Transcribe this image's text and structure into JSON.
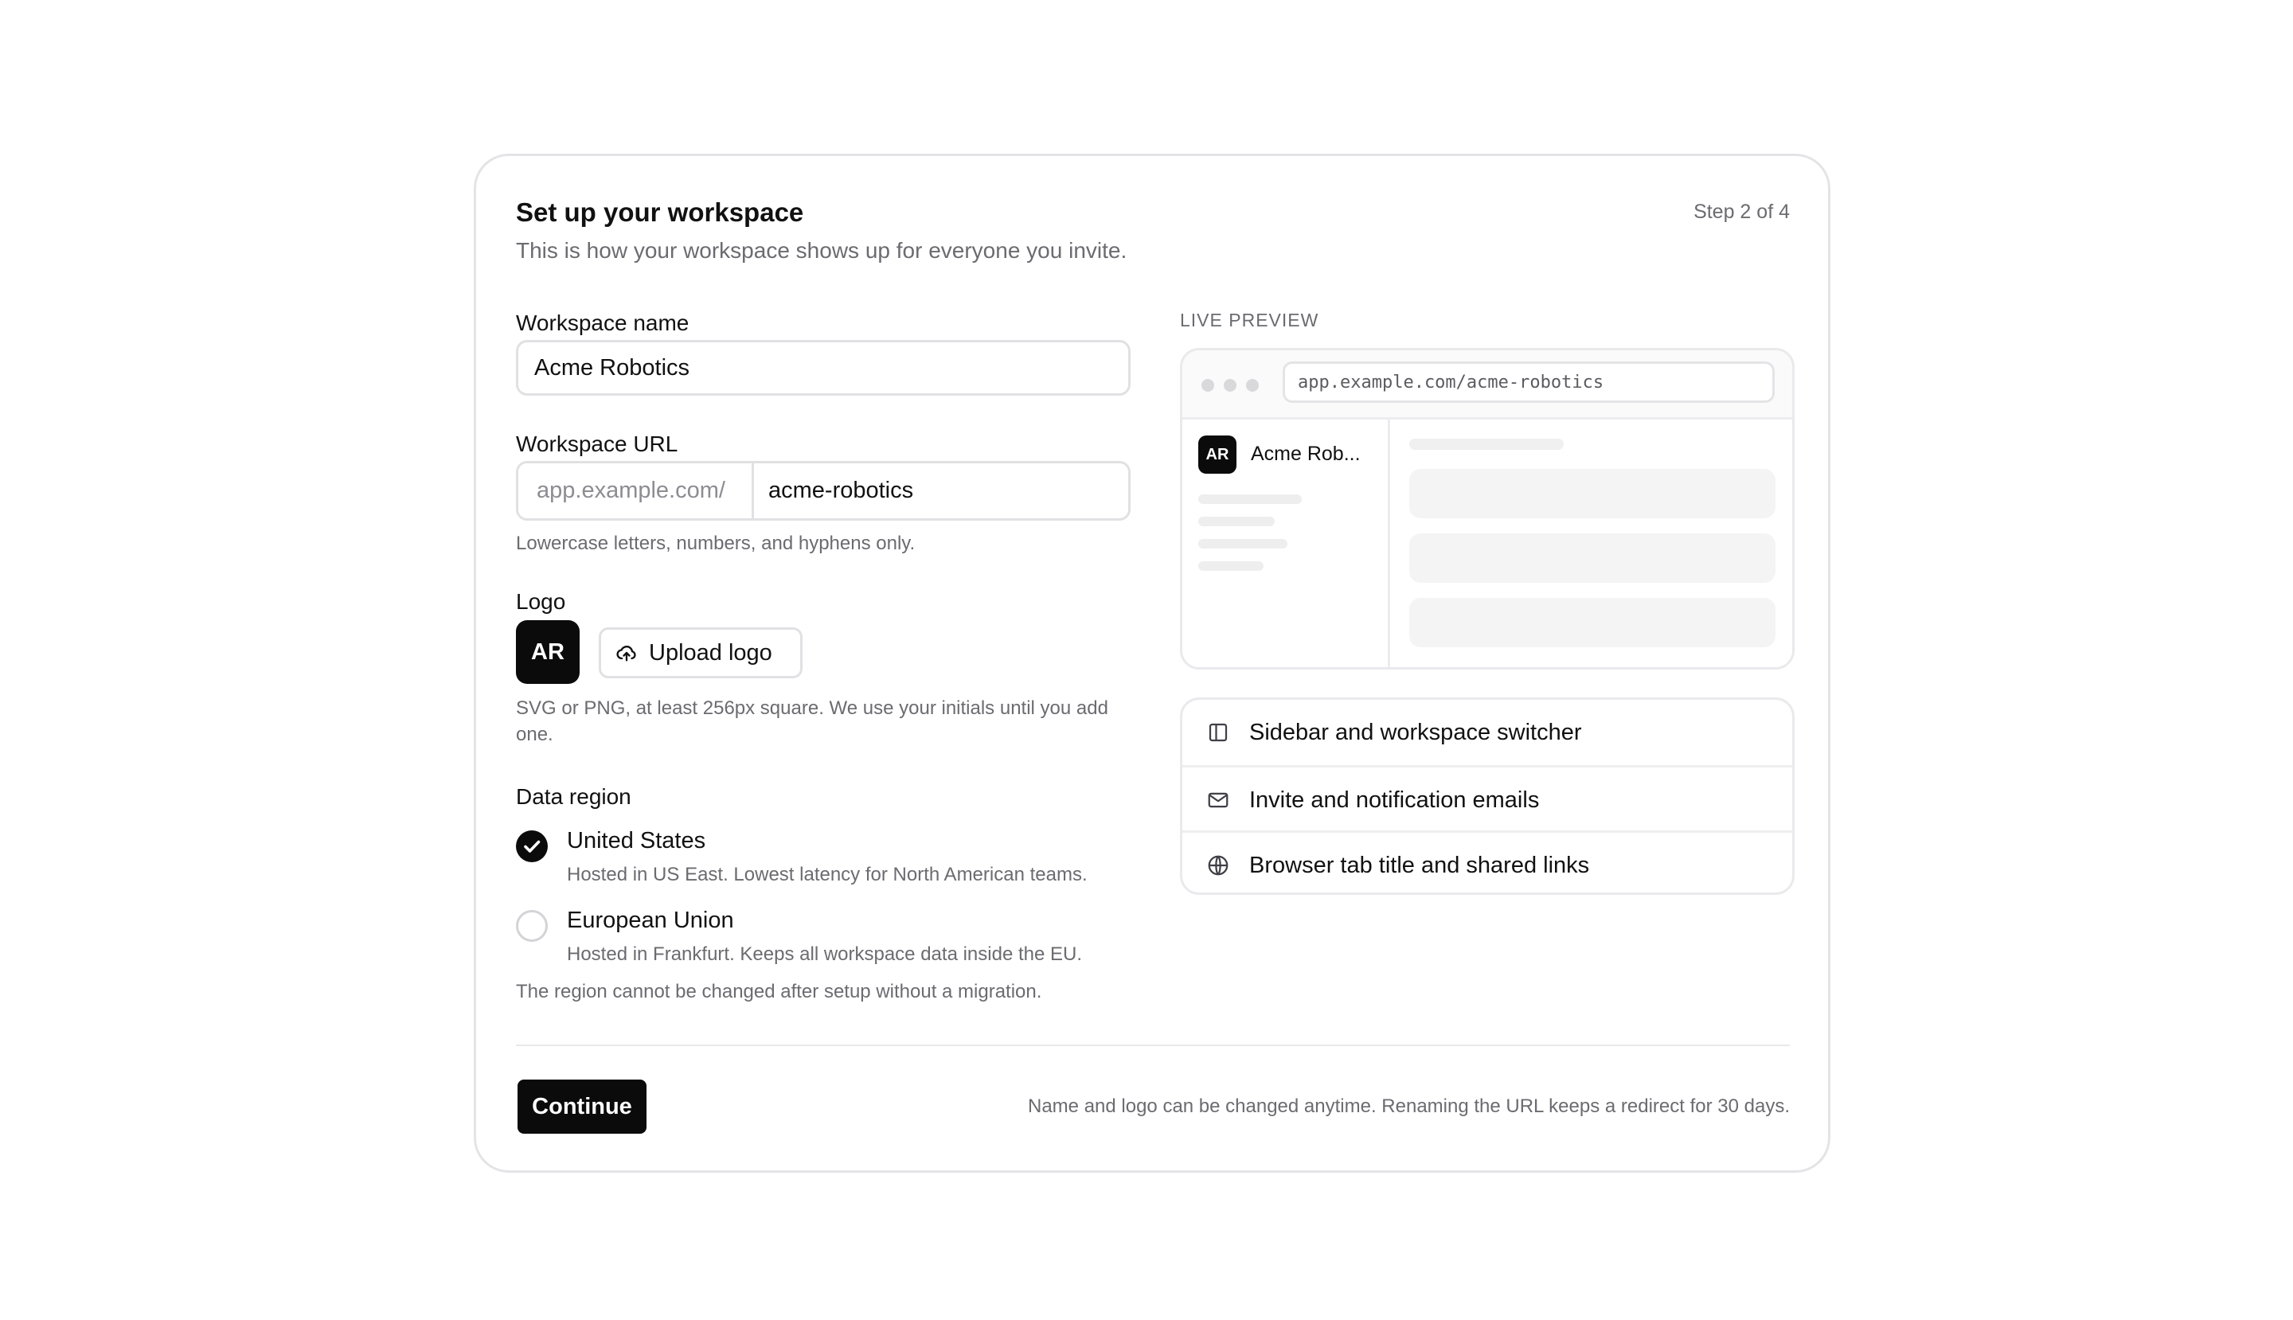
{
  "header": {
    "title": "Set up your workspace",
    "subtitle": "This is how your workspace shows up for everyone you invite.",
    "step": "Step 2 of 4"
  },
  "form": {
    "name_label": "Workspace name",
    "name_value": "Acme Robotics",
    "url_label": "Workspace URL",
    "url_prefix": "app.example.com/",
    "url_value": "acme-robotics",
    "url_help": "Lowercase letters, numbers, and hyphens only.",
    "logo_label": "Logo",
    "logo_initials": "AR",
    "upload_label": "Upload logo",
    "logo_help": "SVG or PNG, at least 256px square. We use your initials until you add one.",
    "region_label": "Data region",
    "regions": [
      {
        "title": "United States",
        "desc": "Hosted in US East. Lowest latency for North American teams.",
        "selected": true
      },
      {
        "title": "European Union",
        "desc": "Hosted in Frankfurt. Keeps all workspace data inside the EU.",
        "selected": false
      }
    ],
    "region_note": "The region cannot be changed after setup without a migration."
  },
  "preview": {
    "label": "LIVE PREVIEW",
    "address": "app.example.com/acme-robotics",
    "avatar": "AR",
    "name": "Acme Rob..."
  },
  "features": [
    {
      "icon": "sidebar-icon",
      "label": "Sidebar and workspace switcher"
    },
    {
      "icon": "mail-icon",
      "label": "Invite and notification emails"
    },
    {
      "icon": "globe-icon",
      "label": "Browser tab title and shared links"
    }
  ],
  "footer": {
    "continue_label": "Continue",
    "note": "Name and logo can be changed anytime. Renaming the URL keeps a redirect for 30 days."
  }
}
